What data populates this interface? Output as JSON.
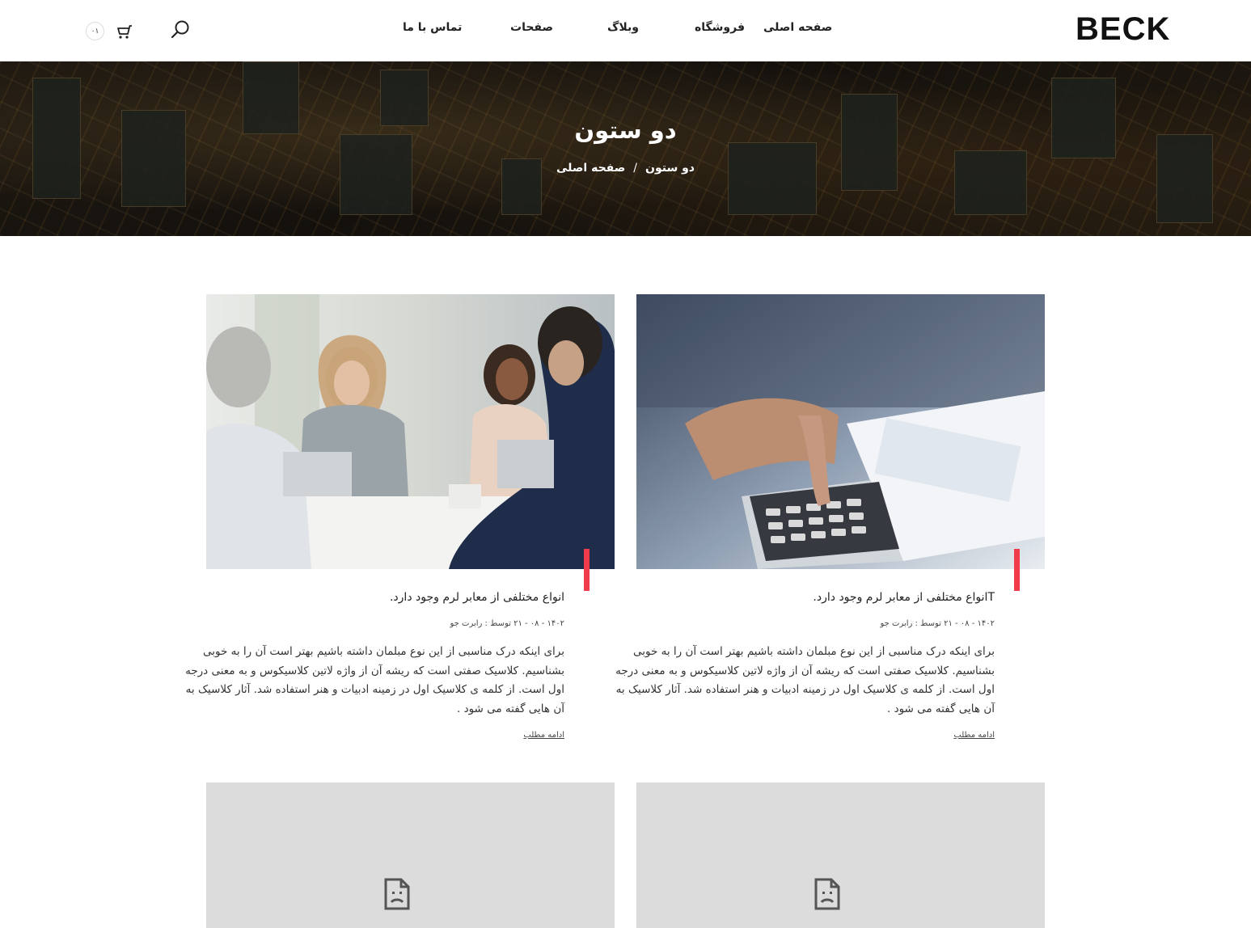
{
  "header": {
    "logo": "BECK",
    "nav": [
      "صفحه اصلی",
      "فروشگاه",
      "وبلاگ",
      "صفحات",
      "تماس با ما"
    ],
    "cart_count": "۰۱"
  },
  "hero": {
    "title": "دو ستون",
    "breadcrumb": {
      "home": "صفحه اصلی",
      "separator": "/",
      "current": "دو ستون"
    }
  },
  "posts": [
    {
      "title": "Tانواع مختلفی از معابر لرم وجود دارد.",
      "meta": "۱۴۰۲ - ۰۸ - ۲۱ توسط : رابرت جو",
      "excerpt": "برای اینکه درک مناسبی از این نوع مبلمان داشته باشیم بهتر است آن را به خوبی بشناسیم. کلاسیک صفتی است که ریشه آن از واژه لاتین کلاسیکوس و به معنی درجه اول است. از کلمه ی کلاسیک اول در زمینه ادبیات و هنر استفاده شد. آثار کلاسیک به آن هایی گفته می شود .",
      "read_more": "ادامه مطلب",
      "image": "calculator-photo"
    },
    {
      "title": "انواع مختلفی از معابر لرم وجود دارد.",
      "meta": "۱۴۰۲ - ۰۸ - ۲۱ توسط : رابرت جو",
      "excerpt": "برای اینکه درک مناسبی از این نوع مبلمان داشته باشیم بهتر است آن را به خوبی بشناسیم. کلاسیک صفتی است که ریشه آن از واژه لاتین کلاسیکوس و به معنی درجه اول است. از کلمه ی کلاسیک اول در زمینه ادبیات و هنر استفاده شد. آثار کلاسیک به آن هایی گفته می شود .",
      "read_more": "ادامه مطلب",
      "image": "meeting-photo"
    }
  ],
  "icons": {
    "search": "search-icon",
    "cart": "cart-icon",
    "broken_image": "broken-image-icon"
  },
  "colors": {
    "accent": "#ef3b4a",
    "placeholder": "#dcdcdc"
  }
}
